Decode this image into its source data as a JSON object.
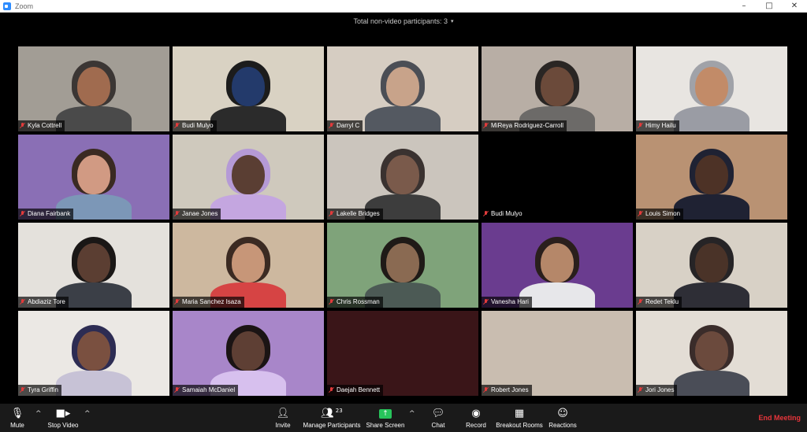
{
  "window": {
    "title": "Zoom",
    "minimize": "–",
    "maximize": "□",
    "close": "✕"
  },
  "top": {
    "non_video_label": "Total non-video participants: 3",
    "caret": "▾"
  },
  "participants": [
    {
      "name": "Kyla Cottrell",
      "bg": "#a29d95",
      "skin": "#a06b4f",
      "hair": "#3b3634",
      "shirt": "#4a4a4a"
    },
    {
      "name": "Budi Mulyo",
      "bg": "#d9d2c3",
      "skin": "#233a6b",
      "hair": "#1c1c1c",
      "shirt": "#2b2b2b"
    },
    {
      "name": "Darryl C",
      "bg": "#d6cdc2",
      "skin": "#c8a38a",
      "hair": "#4b4e55",
      "shirt": "#545961"
    },
    {
      "name": "MiReya Rodriguez-Carroll",
      "bg": "#b8aea5",
      "skin": "#6b4a3a",
      "hair": "#2a2624",
      "shirt": "#6c6a68"
    },
    {
      "name": "Himy Hailu",
      "bg": "#e8e5e1",
      "skin": "#c28b68",
      "hair": "#a0a2a8",
      "shirt": "#9a9ca4"
    },
    {
      "name": "Diana Fairbank",
      "bg": "#8a6fb5",
      "skin": "#d19a83",
      "hair": "#3a2a22",
      "shirt": "#7c97b7"
    },
    {
      "name": "Janae Jones",
      "bg": "#cfc9bd",
      "skin": "#5a3e33",
      "hair": "#b59ad6",
      "shirt": "#c4a6e0"
    },
    {
      "name": "Lakelle Bridges",
      "bg": "#cbc5bd",
      "skin": "#7a5a4b",
      "hair": "#3a3230",
      "shirt": "#3d3d3d"
    },
    {
      "name": "Budi Mulyo",
      "bg": "#000000",
      "skin": "#000000",
      "hair": "#000000",
      "shirt": "#000000",
      "video_off": true
    },
    {
      "name": "Louis Simon",
      "bg": "#b99273",
      "skin": "#4d3226",
      "hair": "#1f2233",
      "shirt": "#1f2233"
    },
    {
      "name": "Abdiaziz Tore",
      "bg": "#e4e1dc",
      "skin": "#5b3e32",
      "hair": "#1a1716",
      "shirt": "#3b3f47"
    },
    {
      "name": "Maria Sanchez Isaza",
      "bg": "#cdb89f",
      "skin": "#c79678",
      "hair": "#3b2a22",
      "shirt": "#d64444"
    },
    {
      "name": "Chris Rossman",
      "bg": "#7fa37a",
      "skin": "#8a6a52",
      "hair": "#1f1a17",
      "shirt": "#4c5a55"
    },
    {
      "name": "Vanesha Hari",
      "bg": "#6a3c8f",
      "skin": "#b58769",
      "hair": "#2a1f1c",
      "shirt": "#e7e7ea"
    },
    {
      "name": "Redet Teklu",
      "bg": "#d8d1c6",
      "skin": "#4a3328",
      "hair": "#262426",
      "shirt": "#2e2e36"
    },
    {
      "name": "Tyra Griffin",
      "bg": "#ebe8e4",
      "skin": "#7a5040",
      "hair": "#2d2c53",
      "shirt": "#c7c2d6"
    },
    {
      "name": "Samaiah McDaniel",
      "bg": "#a886c9",
      "skin": "#5e3f34",
      "hair": "#1b1414",
      "shirt": "#d7c0ee"
    },
    {
      "name": "Daejah Bennett",
      "bg": "#3a1518",
      "skin": "#3a1518",
      "hair": "#3a1518",
      "shirt": "#3a1518",
      "video_off": true
    },
    {
      "name": "Robert Jones",
      "bg": "#c9bdb0",
      "skin": "#c9bdb0",
      "hair": "#c9bdb0",
      "shirt": "#c9bdb0",
      "video_off": true
    },
    {
      "name": "Jori Jones",
      "bg": "#e3ddd5",
      "skin": "#6b4a3d",
      "hair": "#3a2c2a",
      "shirt": "#4a4d57"
    }
  ],
  "toolbar": {
    "mute": "Mute",
    "stop_video": "Stop Video",
    "invite": "Invite",
    "manage_participants": "Manage Participants",
    "participant_count": "23",
    "share_screen": "Share Screen",
    "chat": "Chat",
    "record": "Record",
    "breakout_rooms": "Breakout Rooms",
    "reactions": "Reactions",
    "end_meeting": "End Meeting",
    "caret": "^"
  },
  "colors": {
    "active_speaker_border": "#c9e05a",
    "end_meeting": "#e8353b",
    "share_screen": "#27c45b",
    "muted_mic": "#e23b3b"
  }
}
